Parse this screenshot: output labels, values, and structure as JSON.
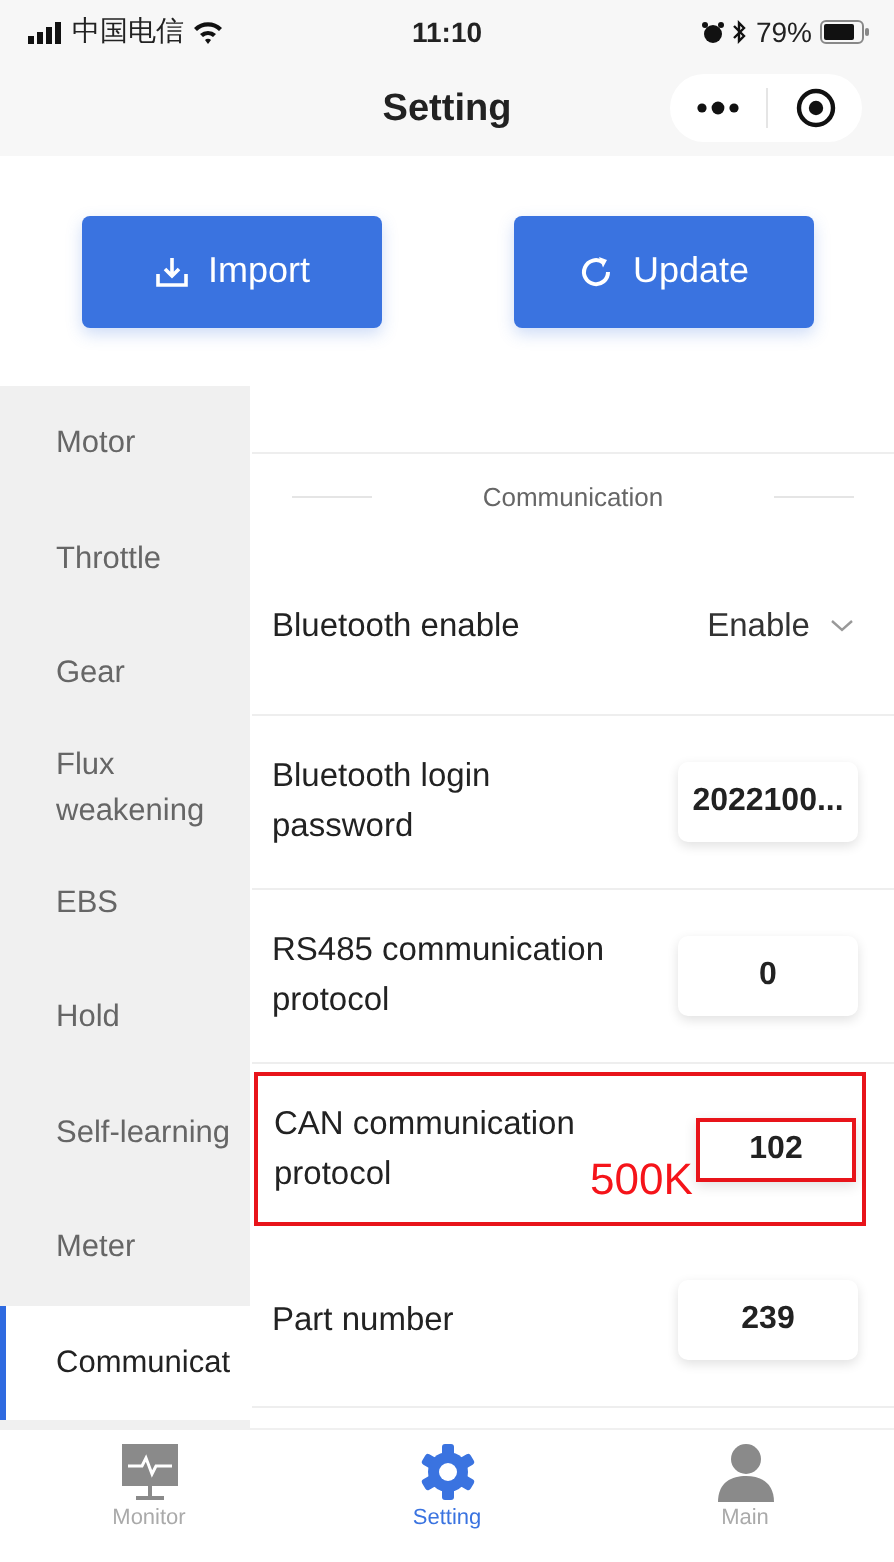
{
  "status_bar": {
    "carrier": "中国电信",
    "time": "11:10",
    "battery": "79%"
  },
  "nav": {
    "title": "Setting"
  },
  "actions": [
    {
      "kind": "import",
      "label": "Import"
    },
    {
      "kind": "update",
      "label": "Update"
    }
  ],
  "sidebar": {
    "items": [
      {
        "label": "Motor",
        "selected": false
      },
      {
        "label": "Throttle",
        "selected": false
      },
      {
        "label": "Gear",
        "selected": false
      },
      {
        "label": "Flux weakening",
        "selected": false
      },
      {
        "label": "EBS",
        "selected": false
      },
      {
        "label": "Hold",
        "selected": false
      },
      {
        "label": "Self-learning",
        "selected": false
      },
      {
        "label": "Meter",
        "selected": false
      },
      {
        "label": "Communicat",
        "selected": true
      }
    ]
  },
  "section": {
    "title": "Communication"
  },
  "settings": [
    {
      "kind": "select",
      "label": "Bluetooth enable",
      "value": "Enable",
      "highlighted": false
    },
    {
      "kind": "input",
      "label": "Bluetooth login password",
      "value": "2022100...",
      "highlighted": false
    },
    {
      "kind": "input",
      "label": "RS485 communication protocol",
      "value": "0",
      "highlighted": false
    },
    {
      "kind": "input",
      "label": "CAN communication protocol",
      "value": "102",
      "highlighted": true,
      "annotation": "500K"
    },
    {
      "kind": "input",
      "label": "Part number",
      "value": "239",
      "highlighted": false
    }
  ],
  "tab_bar": [
    {
      "kind": "monitor",
      "label": "Monitor",
      "selected": false
    },
    {
      "kind": "setting",
      "label": "Setting",
      "selected": true
    },
    {
      "kind": "main",
      "label": "Main",
      "selected": false
    }
  ]
}
